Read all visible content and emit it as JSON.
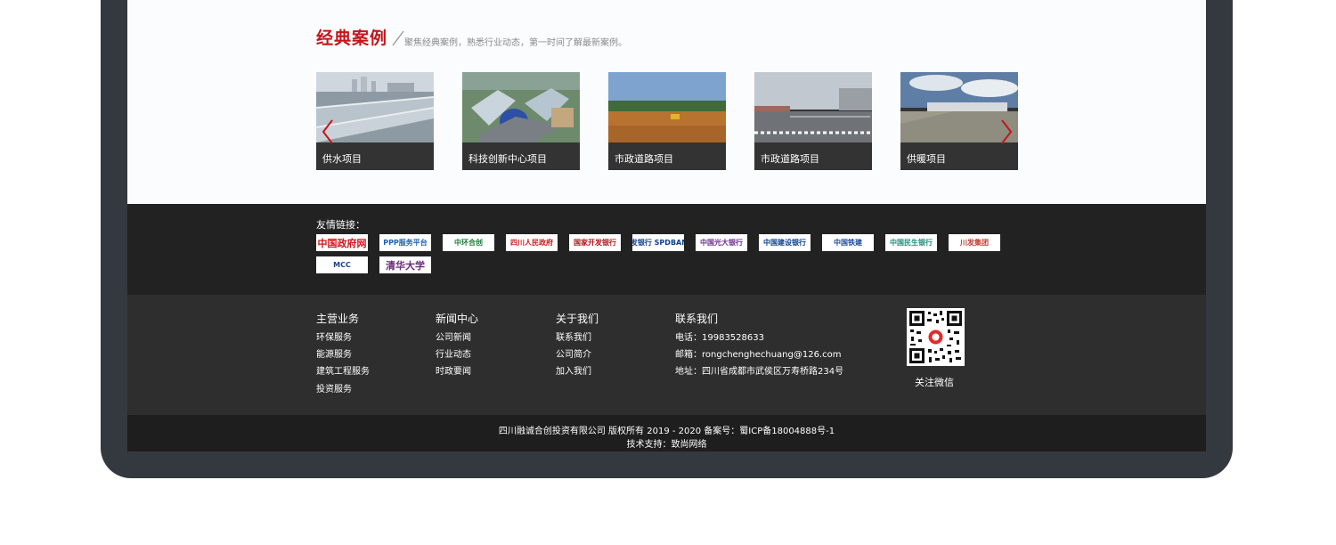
{
  "cases": {
    "title": "经典案例",
    "subtitle": "聚焦经典案例，熟悉行业动态，第一时间了解最新案例。",
    "items": [
      {
        "label": "供水项目"
      },
      {
        "label": "科技创新中心项目"
      },
      {
        "label": "市政道路项目"
      },
      {
        "label": "市政道路项目"
      },
      {
        "label": "供暖项目"
      }
    ],
    "prev_icon": "chevron-left-icon",
    "next_icon": "chevron-right-icon",
    "accent": "#c4161c"
  },
  "links": {
    "title": "友情链接：",
    "logos": [
      {
        "name": "中国政府网"
      },
      {
        "name": "PPP服务平台"
      },
      {
        "name": "中环合创"
      },
      {
        "name": "四川人民政府"
      },
      {
        "name": "国家开发银行"
      },
      {
        "name": "浦发银行 SPDBANK"
      },
      {
        "name": "中国光大银行"
      },
      {
        "name": "中国建设银行"
      },
      {
        "name": "中国铁建"
      },
      {
        "name": "中国民生银行"
      },
      {
        "name": "川发集团"
      },
      {
        "name": "MCC"
      },
      {
        "name": "清华大学"
      }
    ]
  },
  "footer": {
    "columns": [
      {
        "title": "主营业务",
        "items": [
          "环保服务",
          "能源服务",
          "建筑工程服务",
          "投资服务"
        ]
      },
      {
        "title": "新闻中心",
        "items": [
          "公司新闻",
          "行业动态",
          "时政要闻"
        ]
      },
      {
        "title": "关于我们",
        "items": [
          "联系我们",
          "公司简介",
          "加入我们"
        ]
      }
    ],
    "contact": {
      "title": "联系我们",
      "phone": "电话：19983528633",
      "email": "邮箱：rongchenghechuang@126.com",
      "address": "地址：四川省成都市武侯区万寿桥路234号"
    },
    "qr_label": "关注微信"
  },
  "bottom": {
    "copyright": "四川融诚合创投资有限公司 版权所有 2019 - 2020 备案号：蜀ICP备18004888号-1",
    "support": "技术支持：致尚网络"
  }
}
